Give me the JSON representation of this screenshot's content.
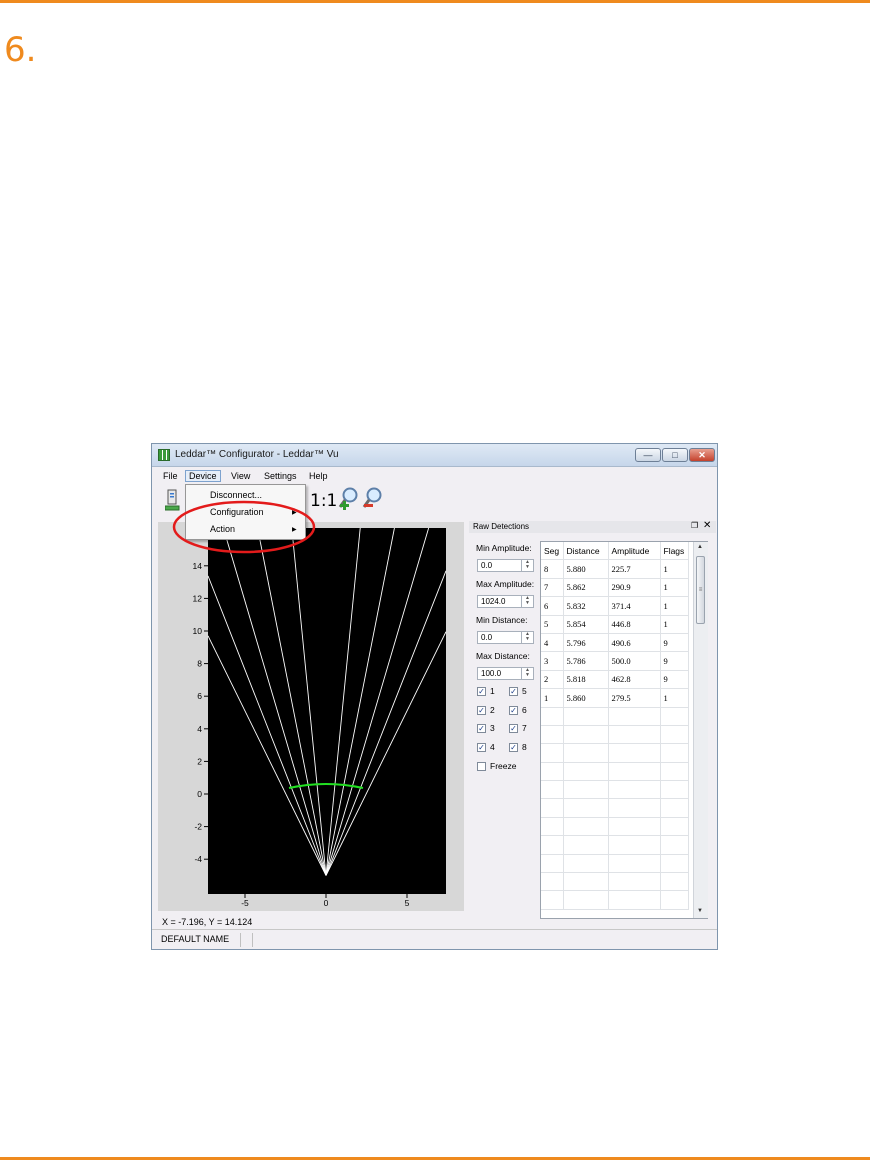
{
  "page": {
    "step_number": "6.",
    "accent_color": "#ef8a1e"
  },
  "window": {
    "title": "Leddar™ Configurator - Leddar™ Vu",
    "controls": {
      "minimize": "—",
      "maximize": "□",
      "close": "✕"
    }
  },
  "menubar": {
    "file": "File",
    "device": "Device",
    "view": "View",
    "settings": "Settings",
    "help": "Help"
  },
  "device_menu": {
    "items": [
      {
        "label": "Disconnect...",
        "submenu": false
      },
      {
        "label": "Configuration",
        "submenu": true
      },
      {
        "label": "Action",
        "submenu": true
      }
    ],
    "highlight_color": "#e31b1b"
  },
  "toolbar": {
    "zoom_ratio_label": "1:1",
    "icons": [
      "connect-icon",
      "device-icon",
      "zoom-in-icon",
      "zoom-out-icon"
    ]
  },
  "plot": {
    "y_ticks": [
      "14",
      "12",
      "10",
      "8",
      "6",
      "4",
      "2",
      "0",
      "-2",
      "-4"
    ],
    "x_ticks": [
      "-5",
      "0",
      "5"
    ],
    "background": "#000000",
    "beam_color": "#ffffff",
    "detection_color": "#22e022"
  },
  "coordinate_readout": "X = -7.196, Y = 14.124",
  "status_bar": {
    "device_name": "DEFAULT NAME"
  },
  "raw_detections": {
    "title": "Raw Detections",
    "float_icon": "❐",
    "close_icon": "✕",
    "min_amplitude": {
      "label": "Min Amplitude:",
      "value": "0.0"
    },
    "max_amplitude": {
      "label": "Max Amplitude:",
      "value": "1024.0"
    },
    "min_distance": {
      "label": "Min Distance:",
      "value": "0.0"
    },
    "max_distance": {
      "label": "Max Distance:",
      "value": "100.0"
    },
    "segment_checkboxes": [
      {
        "label": "1",
        "checked": true
      },
      {
        "label": "5",
        "checked": true
      },
      {
        "label": "2",
        "checked": true
      },
      {
        "label": "6",
        "checked": true
      },
      {
        "label": "3",
        "checked": true
      },
      {
        "label": "7",
        "checked": true
      },
      {
        "label": "4",
        "checked": true
      },
      {
        "label": "8",
        "checked": true
      }
    ],
    "freeze": {
      "label": "Freeze",
      "checked": false
    },
    "table": {
      "headers": [
        "Seg",
        "Distance",
        "Amplitude",
        "Flags"
      ],
      "rows": [
        [
          "8",
          "5.880",
          "225.7",
          "1"
        ],
        [
          "7",
          "5.862",
          "290.9",
          "1"
        ],
        [
          "6",
          "5.832",
          "371.4",
          "1"
        ],
        [
          "5",
          "5.854",
          "446.8",
          "1"
        ],
        [
          "4",
          "5.796",
          "490.6",
          "9"
        ],
        [
          "3",
          "5.786",
          "500.0",
          "9"
        ],
        [
          "2",
          "5.818",
          "462.8",
          "9"
        ],
        [
          "1",
          "5.860",
          "279.5",
          "1"
        ]
      ],
      "empty_rows": 11
    }
  }
}
